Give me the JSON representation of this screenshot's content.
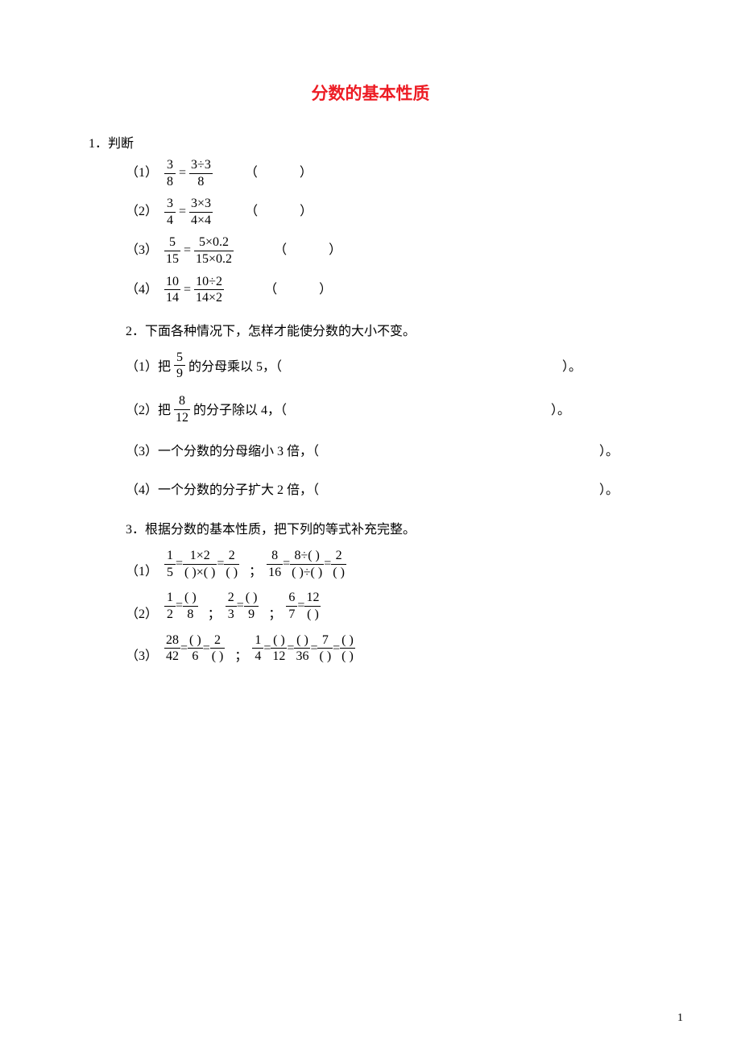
{
  "title": "分数的基本性质",
  "q1": {
    "head": "1．判断",
    "items": [
      {
        "label": "（1）",
        "lhs_num": "3",
        "lhs_den": "8",
        "rhs_num": "3÷3",
        "rhs_den": "8",
        "paren": "（　　　）"
      },
      {
        "label": "（2）",
        "lhs_num": "3",
        "lhs_den": "4",
        "rhs_num": "3×3",
        "rhs_den": "4×4",
        "paren": "（　　　）"
      },
      {
        "label": "（3）",
        "lhs_num": "5",
        "lhs_den": "15",
        "rhs_num": "5×0.2",
        "rhs_den": "15×0.2",
        "paren": "（　　　）"
      },
      {
        "label": "（4）",
        "lhs_num": "10",
        "lhs_den": "14",
        "rhs_num": "10÷2",
        "rhs_den": "14×2",
        "paren": "（　　　）"
      }
    ]
  },
  "q2": {
    "head": "2．下面各种情况下，怎样才能使分数的大小不变。",
    "items": [
      {
        "label": "（1）把",
        "frac_num": "5",
        "frac_den": "9",
        "after": "的分母乘以 5，（",
        "close": "）。"
      },
      {
        "label": "（2）把",
        "frac_num": "8",
        "frac_den": "12",
        "after": "的分子除以 4，（",
        "close": "）。"
      },
      {
        "label": "（3）一个分数的分母缩小 3 倍，（",
        "close": "）。"
      },
      {
        "label": "（4）一个分数的分子扩大 2 倍，（",
        "close": "）。"
      }
    ]
  },
  "q3": {
    "head": "3．根据分数的基本性质，把下列的等式补充完整。",
    "item1": {
      "label": "（1）",
      "a": {
        "n1": "1",
        "d1": "5",
        "n2": "1×2",
        "d2": "(  )×(  )",
        "n3": "2",
        "d3": "(  )"
      },
      "b": {
        "n1": "8",
        "d1": "16",
        "n2": "8÷(  )",
        "d2": "(  )÷(  )",
        "n3": "2",
        "d3": "(  )"
      }
    },
    "item2": {
      "label": "（2）",
      "a": {
        "n1": "1",
        "d1": "2",
        "n2": "(  )",
        "d2": "8"
      },
      "b": {
        "n1": "2",
        "d1": "3",
        "n2": "(  )",
        "d2": "9"
      },
      "c": {
        "n1": "6",
        "d1": "7",
        "n2": "12",
        "d2": "(  )"
      }
    },
    "item3": {
      "label": "（3）",
      "a": {
        "n1": "28",
        "d1": "42",
        "n2": "(  )",
        "d2": "6",
        "n3": "2",
        "d3": "(  )"
      },
      "b": {
        "n1": "1",
        "d1": "4",
        "n2": "(  )",
        "d2": "12",
        "n3": "(  )",
        "d3": "36",
        "n4": "7",
        "d4": "(  )",
        "n5": "(  )",
        "d5": "(  )"
      }
    }
  },
  "page_number": "1",
  "sep_semicolon": "；",
  "sep_comma": "，"
}
